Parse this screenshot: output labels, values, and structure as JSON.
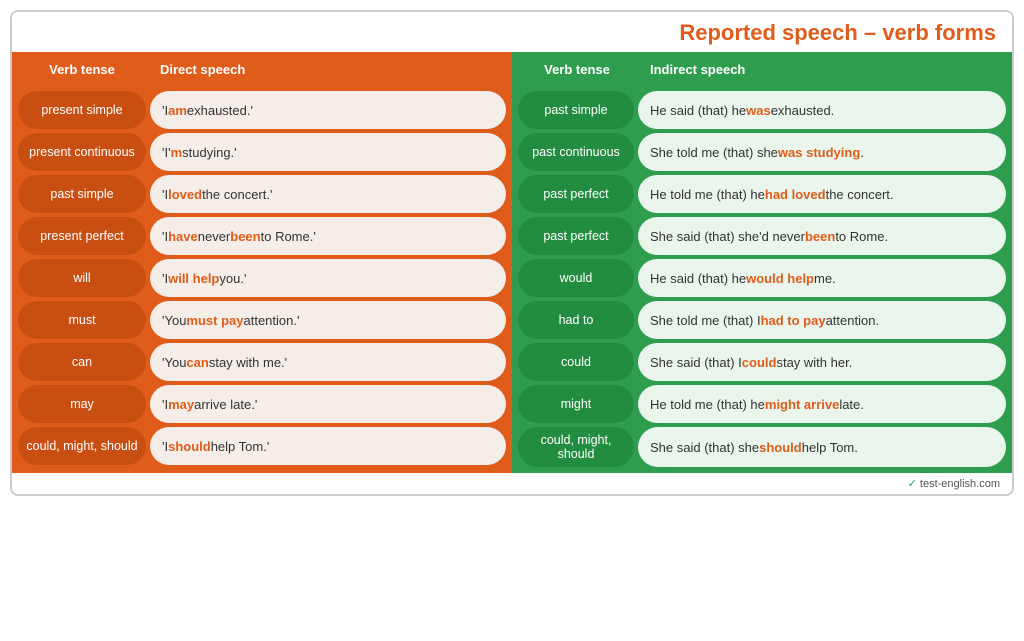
{
  "title": "Reported speech – verb forms",
  "headers": {
    "verb_tense": "Verb tense",
    "direct_speech": "Direct speech",
    "verb_tense2": "Verb tense",
    "indirect_speech": "Indirect speech"
  },
  "rows": [
    {
      "verb_left": "present simple",
      "direct": "'I <o>am</o> exhausted.'",
      "verb_right": "past simple",
      "indirect": "He said (that) he <o>was</o> exhausted."
    },
    {
      "verb_left": "present continuous",
      "direct": "'I'<o>m</o> studying.'",
      "verb_right": "past continuous",
      "indirect": "She told me (that) she <o>was studying</o>."
    },
    {
      "verb_left": "past simple",
      "direct": "'I <o>loved</o> the concert.'",
      "verb_right": "past perfect",
      "indirect": "He told me (that) he <o>had loved</o> the concert."
    },
    {
      "verb_left": "present perfect",
      "direct": "'I <o>have</o> never <o>been</o> to Rome.'",
      "verb_right": "past perfect",
      "indirect": "She said (that) she'd never <o>been</o> to Rome."
    },
    {
      "verb_left": "will",
      "direct": "'I <o>will help</o> you.'",
      "verb_right": "would",
      "indirect": "He said (that) he <o>would help</o> me."
    },
    {
      "verb_left": "must",
      "direct": "'You <o>must pay</o> attention.'",
      "verb_right": "had to",
      "indirect": "She told me (that) I <o>had to pay</o> attention."
    },
    {
      "verb_left": "can",
      "direct": "'You <o>can</o> stay with me.'",
      "verb_right": "could",
      "indirect": "She said (that) I <o>could</o> stay with her."
    },
    {
      "verb_left": "may",
      "direct": "'I <o>may</o> arrive late.'",
      "verb_right": "might",
      "indirect": "He told me (that) he <o>might arrive</o> late."
    },
    {
      "verb_left": "could, might, should",
      "direct": "'I <o>should</o> help Tom.'",
      "verb_right": "could, might, should",
      "indirect": "She said (that) she <o>should</o> help Tom."
    }
  ],
  "footer": "test-english.com"
}
